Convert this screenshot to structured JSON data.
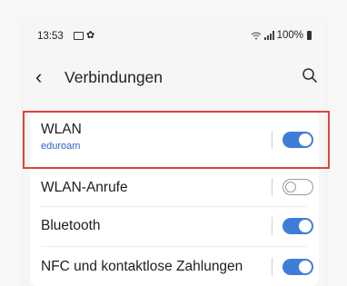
{
  "status_bar": {
    "time": "13:53",
    "battery": "100%",
    "icons": [
      "image-icon",
      "gear-icon",
      "wifi-icon",
      "signal-icon",
      "battery-icon"
    ]
  },
  "header": {
    "back_icon": "chevron-left-icon",
    "title": "Verbindungen",
    "search_icon": "search-icon"
  },
  "settings": {
    "items": [
      {
        "label": "WLAN",
        "subtitle": "eduroam",
        "toggle": "on"
      },
      {
        "label": "WLAN-Anrufe",
        "toggle": "off"
      },
      {
        "label": "Bluetooth",
        "toggle": "on"
      },
      {
        "label": "NFC und kontaktlose Zahlungen",
        "toggle": "on"
      }
    ]
  },
  "colors": {
    "accent": "#3e7ed9",
    "highlight_border": "#d9453c",
    "subtitle": "#2d63c8"
  }
}
